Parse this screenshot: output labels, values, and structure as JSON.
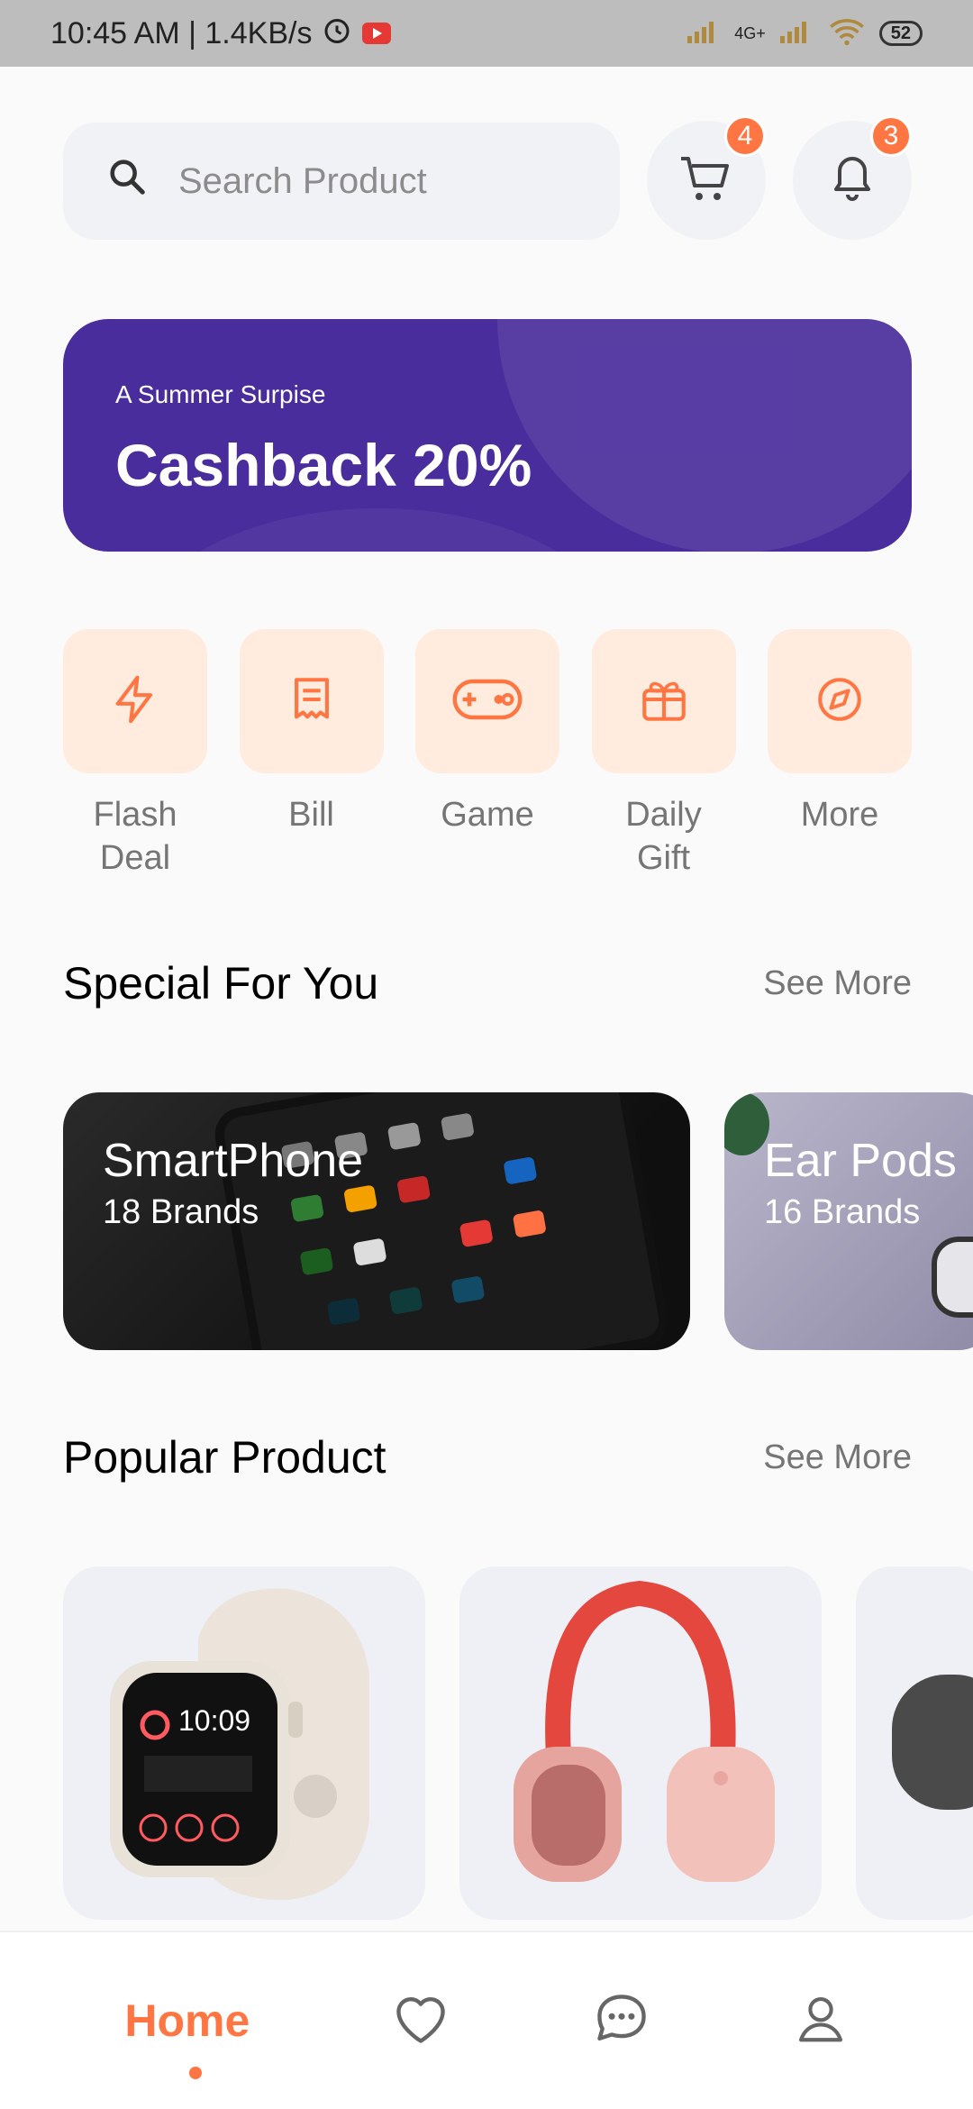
{
  "status_bar": {
    "time_speed": "10:45 AM | 1.4KB/s",
    "network": "4G+",
    "battery": "52"
  },
  "search": {
    "placeholder": "Search Product"
  },
  "header": {
    "cart_badge": "4",
    "notification_badge": "3"
  },
  "banner": {
    "subtitle": "A Summer Surpise",
    "title": "Cashback 20%"
  },
  "categories": [
    {
      "label": "Flash\nDeal",
      "icon": "flash-icon"
    },
    {
      "label": "Bill",
      "icon": "bill-icon"
    },
    {
      "label": "Game",
      "icon": "game-controller-icon"
    },
    {
      "label": "Daily\nGift",
      "icon": "gift-icon"
    },
    {
      "label": "More",
      "icon": "compass-icon"
    }
  ],
  "special_section": {
    "title": "Special For You",
    "see_more": "See More",
    "cards": [
      {
        "title": "SmartPhone",
        "subtitle": "18 Brands"
      },
      {
        "title": "Ear Pods",
        "subtitle": "16 Brands"
      }
    ]
  },
  "popular_section": {
    "title": "Popular Product",
    "see_more": "See More"
  },
  "bottom_nav": {
    "home_label": "Home",
    "active_color": "#ff7643"
  },
  "colors": {
    "accent": "#ff7643",
    "banner": "#4a2d9c",
    "category_bg": "#ffecdf"
  }
}
